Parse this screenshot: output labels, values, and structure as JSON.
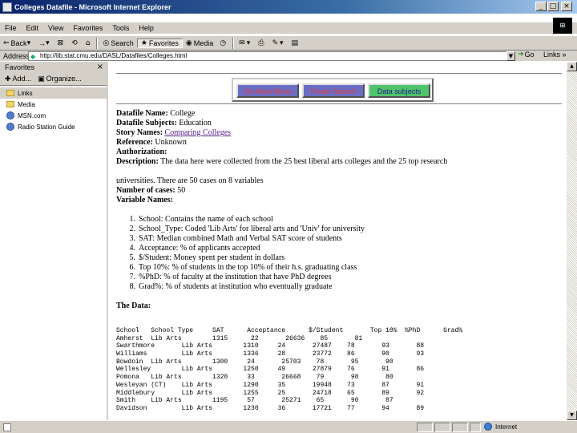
{
  "window": {
    "title": "Colleges Datafile - Microsoft Internet Explorer",
    "buttons": [
      "_",
      "□",
      "×"
    ]
  },
  "menubar": {
    "items": [
      "File",
      "Edit",
      "View",
      "Favorites",
      "Tools",
      "Help"
    ]
  },
  "toolbar": {
    "back": "Back",
    "forward": "→",
    "search": "Search",
    "favorites": "Favorites",
    "media": "Media"
  },
  "address": {
    "label": "Address",
    "value": "http://lib.stat.cmu.edu/DASL/Datafiles/Colleges.html",
    "go": "Go",
    "links": "Links »"
  },
  "favorites_pane": {
    "title": "Favorites",
    "close": "×",
    "add": "Add...",
    "organize": "Organize...",
    "items": [
      {
        "label": "Links",
        "type": "folder"
      },
      {
        "label": "Media",
        "type": "folder"
      },
      {
        "label": "MSN.com",
        "type": "url"
      },
      {
        "label": "Radio Station Guide",
        "type": "url"
      }
    ]
  },
  "nav_buttons": {
    "main_menu": "Go Main Menu",
    "power_search": "Power Search",
    "data_subjects": "Data subjects"
  },
  "doc": {
    "datafile_name_label": "Datafile Name:",
    "datafile_name": "College",
    "subjects_label": "Datafile Subjects:",
    "subjects": "Education",
    "story_label": "Story Names:",
    "story_link": "Comparing Colleges",
    "reference_label": "Reference:",
    "reference": "Unknown",
    "authorization_label": "Authorization:",
    "description_label": "Description:",
    "description": "The data here were collected from the 25 best liberal arts colleges and the 25 top research",
    "description_cont": "universities. There are 50 cases on 8 variables",
    "cases_label": "Number of cases:",
    "cases": "50",
    "variables_label": "Variable Names:",
    "variables": [
      {
        "n": "1.",
        "text": "School: Contains the name of each school"
      },
      {
        "n": "2.",
        "text": "School_Type: Coded 'Lib Arts' for liberal arts and 'Univ' for university"
      },
      {
        "n": "3.",
        "text": "SAT: Median combined Math and Verbal SAT score of students"
      },
      {
        "n": "4.",
        "text": "Acceptance: % of applicants accepted"
      },
      {
        "n": "5.",
        "text": "$/Student: Money spent per student in dollars"
      },
      {
        "n": "6.",
        "text": "Top 10%: % of students in the top 10% of their h.s. graduating class"
      },
      {
        "n": "7.",
        "text": "%PhD: % of faculty at the institution that have PhD degrees"
      },
      {
        "n": "8.",
        "text": "Grad%: % of students at institution who eventually graduate"
      }
    ],
    "data_label": "The Data:"
  },
  "data_table": {
    "header": "School   School Type     SAT      Acceptance      $/Student       Top 10%  %PhD      Grad%",
    "rows": [
      "Amherst  Lib Arts        1315      22       26636    85       81",
      "Swarthmore       Lib Arts        1310     24       27487    78       93       88",
      "Williams         Lib Arts        1336     28       23772    86       90       93",
      "Bowdoin  Lib Arts        1300     24       25703    78       95       90",
      "Wellesley        Lib Arts        1250     49       27879    76       91       86",
      "Pomona   Lib Arts        1320     33       26668    79       98       80",
      "Wesleyan (CT)    Lib Arts        1290     35       19948    73       87       91",
      "Middlebury       Lib Arts        1255     25       24718    65       89       92",
      "Smith    Lib Arts        1195     57       25271    65       90       87",
      "Davidson         Lib Arts        1230     36       17721    77       94       89"
    ]
  },
  "status": {
    "zone": "Internet"
  }
}
